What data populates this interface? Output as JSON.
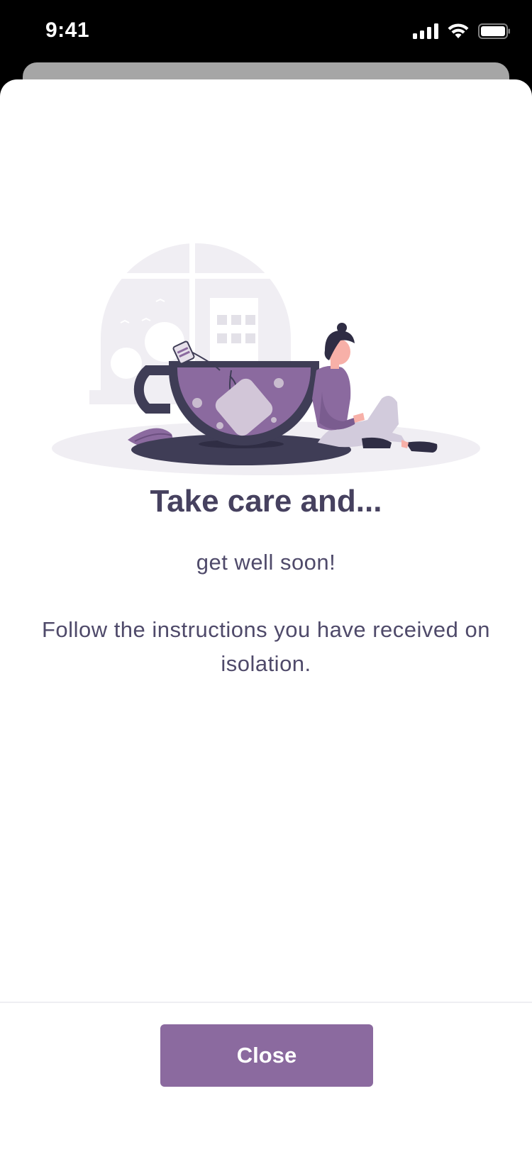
{
  "status_bar": {
    "time": "9:41",
    "icons": [
      "signal-icon",
      "wifi-icon",
      "battery-icon"
    ]
  },
  "modal": {
    "illustration": "woman-with-teacup-illustration",
    "title": "Take care and...",
    "subtitle": "get well soon!",
    "body": "Follow the instructions you have received on isolation.",
    "close_label": "Close"
  },
  "colors": {
    "accent": "#8b6a9f",
    "text": "#46415f",
    "status_bar_bg": "#000000"
  }
}
